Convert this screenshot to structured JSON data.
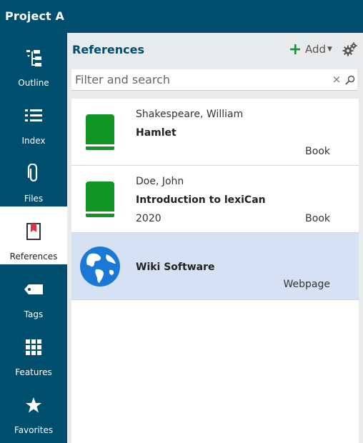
{
  "app": {
    "project_title": "Project A"
  },
  "sidebar": {
    "items": [
      {
        "key": "outline",
        "label": "Outline",
        "icon": "outline-icon"
      },
      {
        "key": "index",
        "label": "Index",
        "icon": "list-icon"
      },
      {
        "key": "files",
        "label": "Files",
        "icon": "paperclip-icon"
      },
      {
        "key": "references",
        "label": "References",
        "icon": "bookmark-icon",
        "active": true
      },
      {
        "key": "tags",
        "label": "Tags",
        "icon": "tag-icon"
      },
      {
        "key": "features",
        "label": "Features",
        "icon": "grid-icon"
      },
      {
        "key": "favorites",
        "label": "Favorites",
        "icon": "star-icon"
      }
    ]
  },
  "panel": {
    "title": "References",
    "add_label": "Add",
    "search_placeholder": "Filter and search",
    "clear_glyph": "×"
  },
  "references": [
    {
      "author": "Shakespeare, William",
      "title": "Hamlet",
      "year": "",
      "type": "Book",
      "icon": "book-icon",
      "selected": false
    },
    {
      "author": "Doe, John",
      "title": "Introduction to lexiCan",
      "year": "2020",
      "type": "Book",
      "icon": "book-icon",
      "selected": false
    },
    {
      "author": "",
      "title": "Wiki Software",
      "year": "",
      "type": "Webpage",
      "icon": "globe-icon",
      "selected": true
    }
  ],
  "colors": {
    "brand": "#004e6e",
    "book_green": "#119626",
    "globe_blue": "#1a78d6",
    "selection": "#d6e2f3",
    "add_plus": "#1e8c3a"
  }
}
